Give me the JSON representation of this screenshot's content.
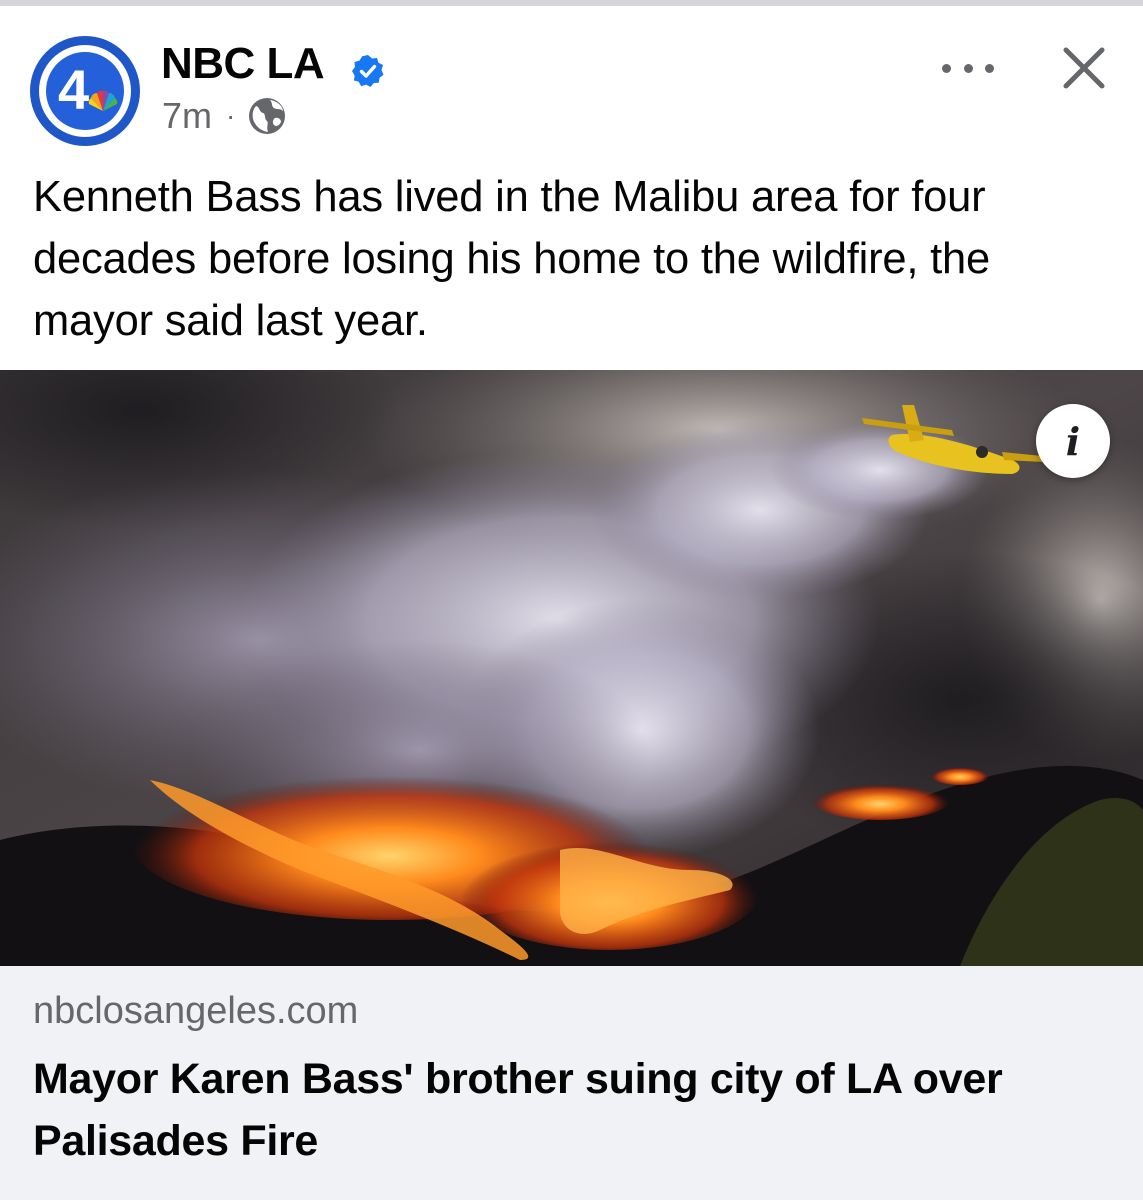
{
  "post": {
    "page_name": "NBC LA",
    "avatar_number": "4",
    "verified_icon": "verified-badge-icon",
    "time": "7m",
    "separator": "·",
    "audience_icon": "globe-icon",
    "text": "Kenneth Bass has lived in the Malibu area for four decades before losing his home to the wildfire, the mayor said last year."
  },
  "actions": {
    "more_icon": "more-options-icon",
    "close_icon": "close-icon"
  },
  "media": {
    "info_label": "i",
    "image_icon": "wildfire-photo"
  },
  "link_preview": {
    "domain": "nbclosangeles.com",
    "title": "Mayor Karen Bass' brother suing city of LA over Palisades Fire"
  },
  "colors": {
    "brand_blue": "#2460d9",
    "verified_blue": "#1877f2",
    "secondary_text": "#65676b",
    "card_bg": "#f0f2f5"
  }
}
